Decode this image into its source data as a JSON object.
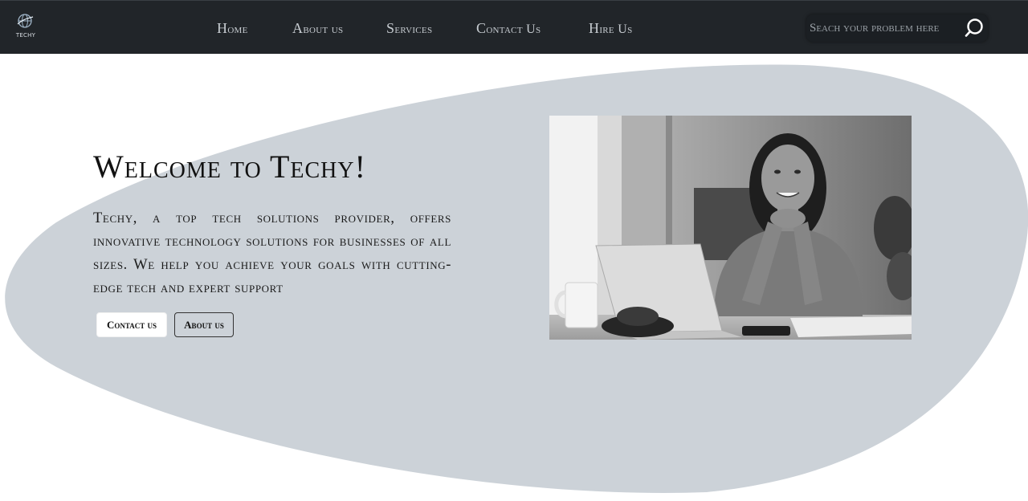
{
  "header": {
    "logo_text": "TECHY",
    "nav": [
      "Home",
      "About us",
      "Services",
      "Contact Us",
      "Hire Us"
    ],
    "search": {
      "placeholder": "Seach your problem here"
    }
  },
  "hero": {
    "title": "Welcome to Techy!",
    "description": "Techy, a top tech solutions provider, offers innovative technology solutions for businesses of all sizes. We help you achieve your goals with cutting-edge tech and expert support",
    "buttons": {
      "contact": "Contact us",
      "about": "About us"
    }
  },
  "colors": {
    "navbar_bg": "#212529",
    "blob": "#ccd2d8",
    "text": "#111111"
  },
  "icons": [
    "globe-logo-icon",
    "search-icon"
  ]
}
